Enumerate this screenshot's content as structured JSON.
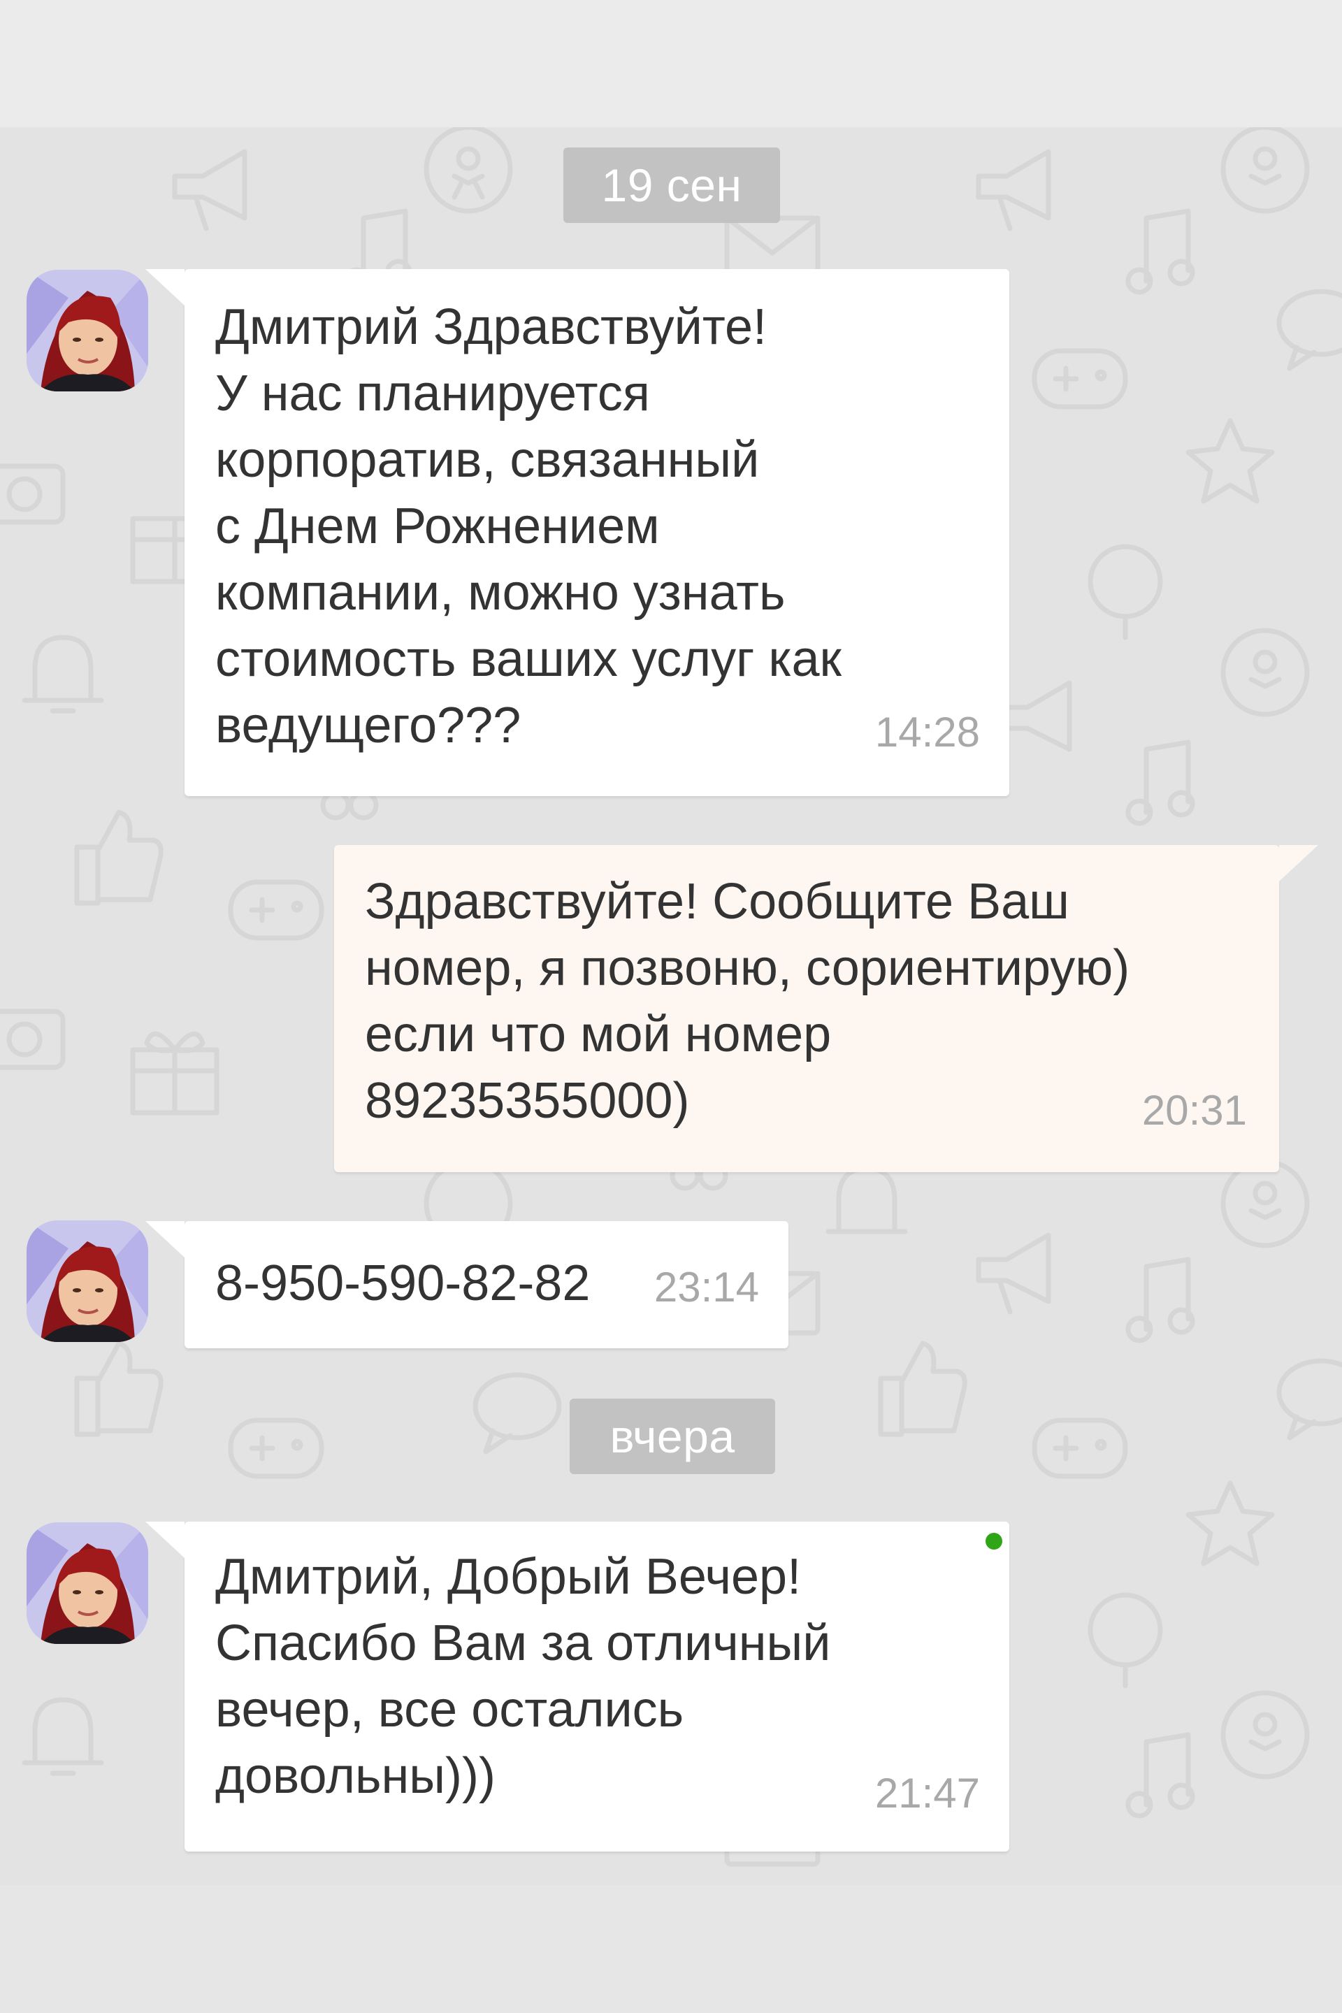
{
  "colors": {
    "chat_background": "#e3e3e3",
    "incoming_bubble": "#ffffff",
    "outgoing_bubble": "#fdf6f1",
    "date_pill": "#c2c2c2",
    "message_text": "#333333",
    "timestamp_text": "#a8a8a8",
    "online_indicator": "#2fa617"
  },
  "date_separators": [
    {
      "label": "19 сен"
    },
    {
      "label": "вчера"
    }
  ],
  "messages": [
    {
      "direction": "incoming",
      "avatar": "contact-avatar",
      "text": "Дмитрий Здравствуйте!\nУ нас планируется\nкорпоратив, связанный\nс Днем Рожнением\nкомпании, можно узнать\nстоимость ваших услуг как\nведущего???",
      "time": "14:28"
    },
    {
      "direction": "outgoing",
      "text": "Здравствуйте! Сообщите Ваш\nномер, я позвоню, сориентирую)\nесли что мой номер\n89235355000)",
      "time": "20:31"
    },
    {
      "direction": "incoming",
      "avatar": "contact-avatar",
      "text": "8-950-590-82-82",
      "time": "23:14"
    },
    {
      "direction": "incoming",
      "avatar": "contact-avatar",
      "text": "Дмитрий, Добрый Вечер!\nСпасибо Вам за отличный\nвечер, все остались\nдовольны)))",
      "time": "21:47",
      "online_indicator": true
    }
  ],
  "background_icons": [
    "megaphone-icon",
    "music-note-icon",
    "gamepad-icon",
    "star-icon",
    "balloon-icon",
    "ok-logo-icon",
    "bell-icon",
    "thumbs-up-icon",
    "gift-icon",
    "camera-icon",
    "speech-bubble-icon",
    "envelope-icon"
  ]
}
